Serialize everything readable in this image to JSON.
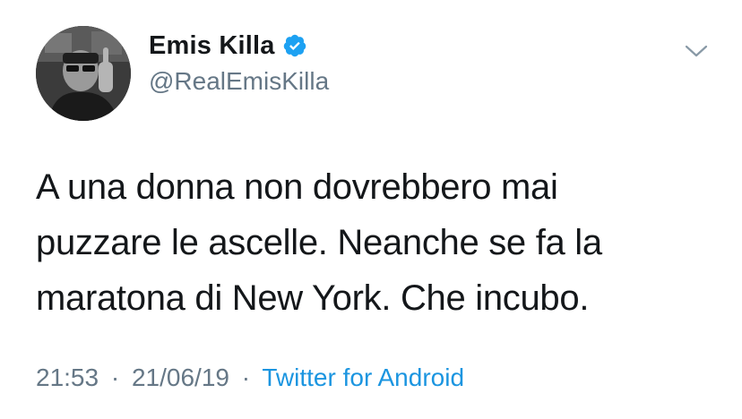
{
  "user": {
    "display_name": "Emis Killa",
    "handle": "@RealEmisKilla",
    "verified": true,
    "avatar_icon": "profile-photo"
  },
  "tweet": {
    "lines": [
      "A una donna non dovrebbero mai",
      "puzzare le ascelle. Neanche se fa la",
      "maratona di New York. Che incubo."
    ]
  },
  "meta": {
    "time": "21:53",
    "separator": "·",
    "date": "21/06/19",
    "source": "Twitter for Android"
  },
  "colors": {
    "text": "#14171a",
    "secondary": "#657786",
    "accent": "#1b95e0",
    "verified": "#1da1f2"
  },
  "icons": {
    "verified": "verified-badge-icon",
    "menu": "chevron-down-icon"
  }
}
